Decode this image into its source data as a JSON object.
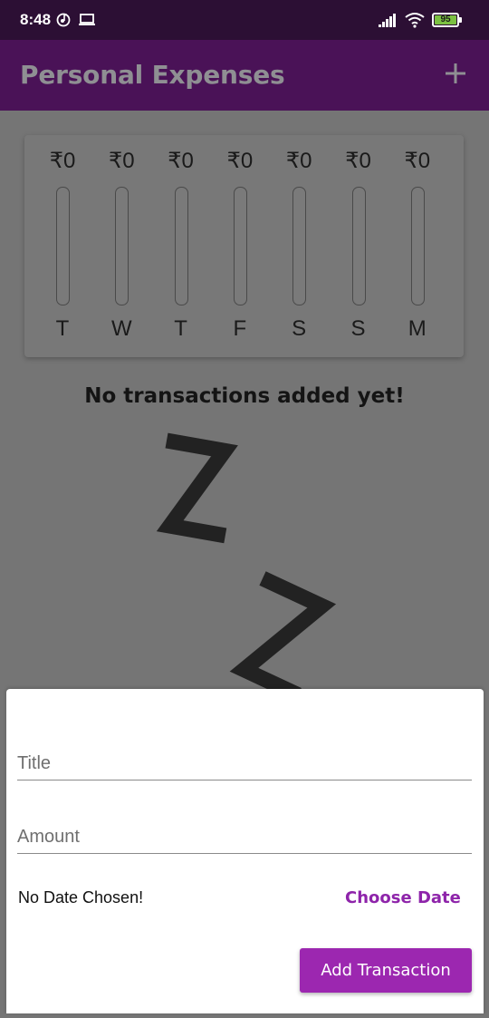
{
  "status_bar": {
    "time": "8:48",
    "battery": "95"
  },
  "app_bar": {
    "title": "Personal Expenses"
  },
  "chart_data": {
    "type": "bar",
    "categories": [
      "T",
      "W",
      "T",
      "F",
      "S",
      "S",
      "M"
    ],
    "values": [
      0,
      0,
      0,
      0,
      0,
      0,
      0
    ],
    "value_labels": [
      "₹0",
      "₹0",
      "₹0",
      "₹0",
      "₹0",
      "₹0",
      "₹0"
    ],
    "ylim": [
      0,
      1
    ]
  },
  "empty_state": {
    "message": "No transactions added yet!"
  },
  "form": {
    "title_placeholder": "Title",
    "amount_placeholder": "Amount",
    "date_status": "No Date Chosen!",
    "choose_date_label": "Choose Date",
    "submit_label": "Add Transaction"
  },
  "colors": {
    "primary": "#4a1257",
    "accent": "#9c27b0"
  }
}
